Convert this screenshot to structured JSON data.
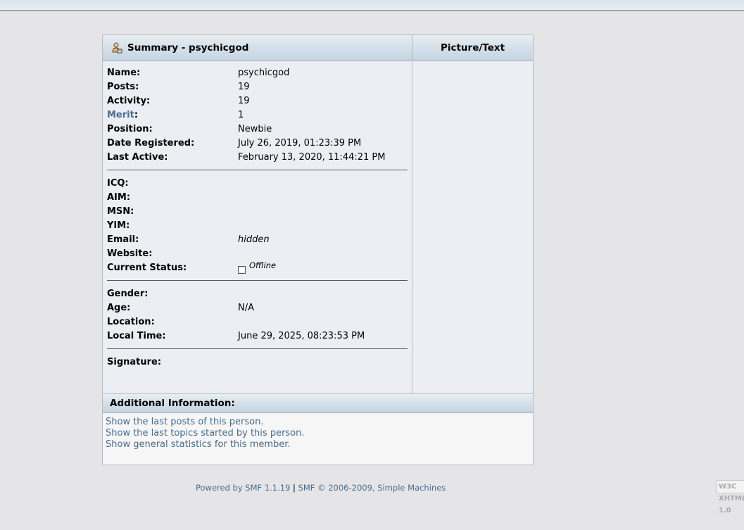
{
  "header": {
    "summary_title": "Summary - psychicgod",
    "picture_title": "Picture/Text"
  },
  "profile": {
    "name_label": "Name:",
    "name": "psychicgod",
    "posts_label": "Posts:",
    "posts": "19",
    "activity_label": "Activity:",
    "activity": "19",
    "merit_link": "Merit",
    "merit_colon": ":",
    "merit": "1",
    "position_label": "Position:",
    "position": "Newbie",
    "registered_label": "Date Registered:",
    "registered": "July 26, 2019, 01:23:39 PM",
    "last_active_label": "Last Active:",
    "last_active": "February 13, 2020, 11:44:21 PM",
    "icq_label": "ICQ:",
    "aim_label": "AIM:",
    "msn_label": "MSN:",
    "yim_label": "YIM:",
    "email_label": "Email:",
    "email": "hidden",
    "website_label": "Website:",
    "status_label": "Current Status:",
    "status": "Offline",
    "gender_label": "Gender:",
    "age_label": "Age:",
    "age": "N/A",
    "location_label": "Location:",
    "local_time_label": "Local Time:",
    "local_time": "June 29, 2025, 08:23:53 PM",
    "signature_label": "Signature:"
  },
  "additional": {
    "title": "Additional Information:",
    "links": [
      "Show the last posts of this person.",
      "Show the last topics started by this person.",
      "Show general statistics for this member."
    ]
  },
  "footer": {
    "powered": "Powered by SMF 1.1.19",
    "separator": "|",
    "copyright": "SMF © 2006-2009, Simple Machines",
    "w3c_badge": "W3C XHTML 1.0"
  },
  "colors": {
    "link": "#476c8e",
    "header_gradient_end": "#c6d5e1",
    "panel_bg": "#eceef3"
  },
  "icons": {
    "summary": "user-profile-icon",
    "status": "offline-status-icon"
  }
}
